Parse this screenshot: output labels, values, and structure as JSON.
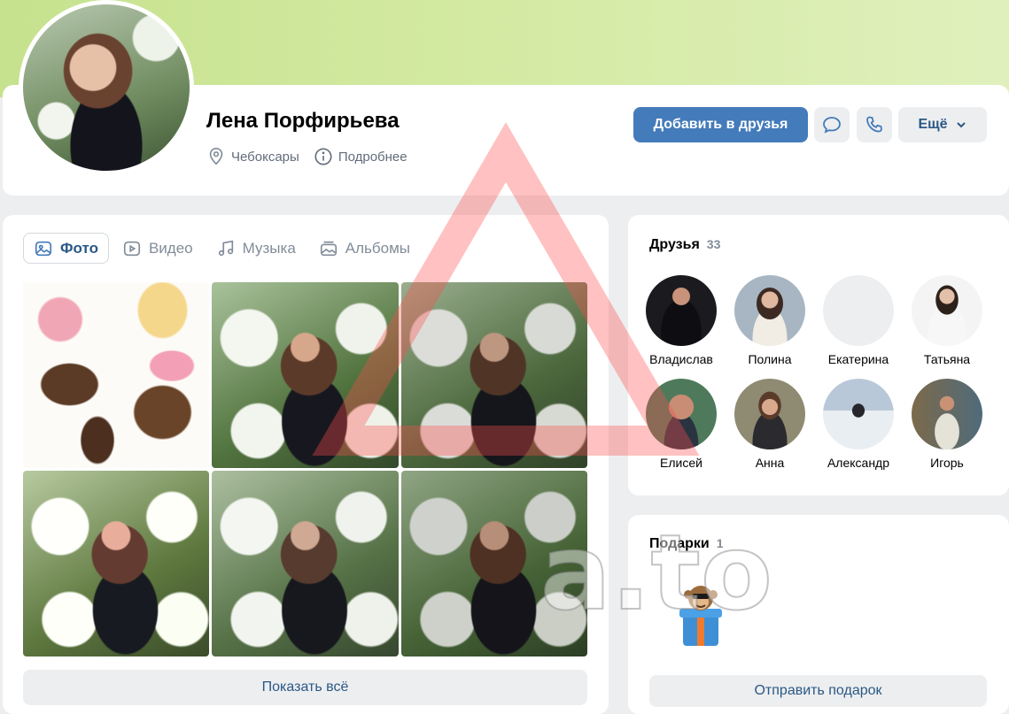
{
  "profile": {
    "name": "Лена Порфирьева",
    "city": "Чебоксары",
    "details_label": "Подробнее"
  },
  "actions": {
    "add_friend": "Добавить в друзья",
    "more": "Ещё"
  },
  "media": {
    "tabs": [
      {
        "label": "Фото",
        "icon": "photo-icon",
        "active": true
      },
      {
        "label": "Видео",
        "icon": "video-icon",
        "active": false
      },
      {
        "label": "Музыка",
        "icon": "music-icon",
        "active": false
      },
      {
        "label": "Альбомы",
        "icon": "albums-icon",
        "active": false
      }
    ],
    "show_all": "Показать всё"
  },
  "friends": {
    "title": "Друзья",
    "count": "33",
    "items": [
      {
        "name": "Владислав"
      },
      {
        "name": "Полина"
      },
      {
        "name": "Екатерина"
      },
      {
        "name": "Татьяна"
      },
      {
        "name": "Елисей"
      },
      {
        "name": "Анна"
      },
      {
        "name": "Александр"
      },
      {
        "name": "Игорь"
      }
    ]
  },
  "gifts": {
    "title": "Подарки",
    "count": "1",
    "send_label": "Отправить подарок"
  },
  "watermark": {
    "text": "a.to"
  },
  "colors": {
    "accent": "#447bba",
    "link": "#2a5885",
    "secondary_text": "#818c99",
    "background": "#edeef0"
  }
}
